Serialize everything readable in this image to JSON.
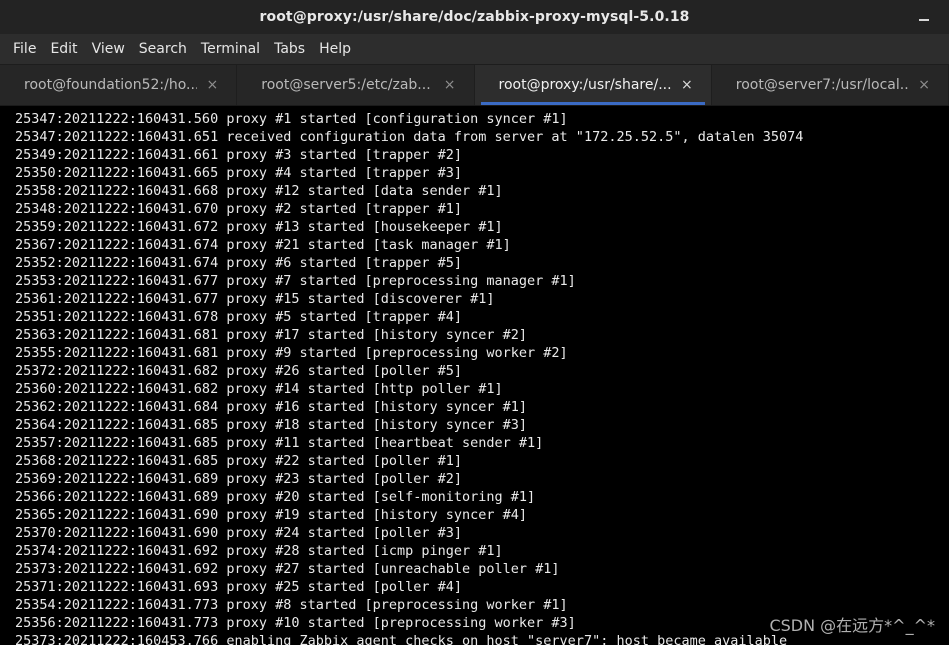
{
  "window": {
    "title": "root@proxy:/usr/share/doc/zabbix-proxy-mysql-5.0.18"
  },
  "menu": {
    "items": [
      "File",
      "Edit",
      "View",
      "Search",
      "Terminal",
      "Tabs",
      "Help"
    ]
  },
  "tabs": [
    {
      "label": "root@foundation52:/ho...",
      "close": "×",
      "active": false
    },
    {
      "label": "root@server5:/etc/zab...",
      "close": "×",
      "active": false
    },
    {
      "label": "root@proxy:/usr/share/...",
      "close": "×",
      "active": true
    },
    {
      "label": "root@server7:/usr/local...",
      "close": "×",
      "active": false
    }
  ],
  "terminal": {
    "lines": [
      "25347:20211222:160431.560 proxy #1 started [configuration syncer #1]",
      "25347:20211222:160431.651 received configuration data from server at \"172.25.52.5\", datalen 35074",
      "25349:20211222:160431.661 proxy #3 started [trapper #2]",
      "25350:20211222:160431.665 proxy #4 started [trapper #3]",
      "25358:20211222:160431.668 proxy #12 started [data sender #1]",
      "25348:20211222:160431.670 proxy #2 started [trapper #1]",
      "25359:20211222:160431.672 proxy #13 started [housekeeper #1]",
      "25367:20211222:160431.674 proxy #21 started [task manager #1]",
      "25352:20211222:160431.674 proxy #6 started [trapper #5]",
      "25353:20211222:160431.677 proxy #7 started [preprocessing manager #1]",
      "25361:20211222:160431.677 proxy #15 started [discoverer #1]",
      "25351:20211222:160431.678 proxy #5 started [trapper #4]",
      "25363:20211222:160431.681 proxy #17 started [history syncer #2]",
      "25355:20211222:160431.681 proxy #9 started [preprocessing worker #2]",
      "25372:20211222:160431.682 proxy #26 started [poller #5]",
      "25360:20211222:160431.682 proxy #14 started [http poller #1]",
      "25362:20211222:160431.684 proxy #16 started [history syncer #1]",
      "25364:20211222:160431.685 proxy #18 started [history syncer #3]",
      "25357:20211222:160431.685 proxy #11 started [heartbeat sender #1]",
      "25368:20211222:160431.685 proxy #22 started [poller #1]",
      "25369:20211222:160431.689 proxy #23 started [poller #2]",
      "25366:20211222:160431.689 proxy #20 started [self-monitoring #1]",
      "25365:20211222:160431.690 proxy #19 started [history syncer #4]",
      "25370:20211222:160431.690 proxy #24 started [poller #3]",
      "25374:20211222:160431.692 proxy #28 started [icmp pinger #1]",
      "25373:20211222:160431.692 proxy #27 started [unreachable poller #1]",
      "25371:20211222:160431.693 proxy #25 started [poller #4]",
      "25354:20211222:160431.773 proxy #8 started [preprocessing worker #1]",
      "25356:20211222:160431.773 proxy #10 started [preprocessing worker #3]",
      "25373:20211222:160453.766 enabling Zabbix agent checks on host \"server7\": host became available"
    ]
  },
  "watermark": "CSDN @在远方*^_^*"
}
